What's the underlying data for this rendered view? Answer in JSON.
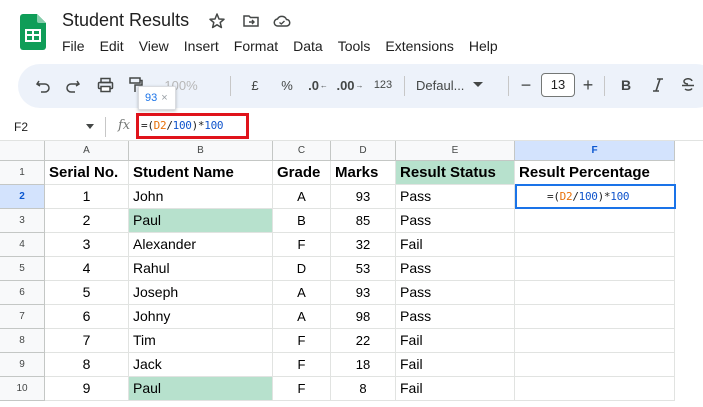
{
  "app": {
    "doc_title": "Student Results",
    "menu": [
      "File",
      "Edit",
      "View",
      "Insert",
      "Format",
      "Data",
      "Tools",
      "Extensions",
      "Help"
    ]
  },
  "toolbar": {
    "zoom": "100%",
    "currency": "£",
    "percent": "%",
    "dec_decrease": ".0",
    "dec_increase": ".00",
    "number_format": "123",
    "font": "Defaul...",
    "font_size": "13",
    "bold": "B",
    "minus": "−",
    "plus": "+"
  },
  "tooltip": {
    "value": "93",
    "close": "×"
  },
  "formula_bar": {
    "name_box": "F2",
    "fx": "fx",
    "tokens": [
      {
        "t": "=(",
        "k": "eq"
      },
      {
        "t": "D2",
        "k": "ref"
      },
      {
        "t": "/",
        "k": "op"
      },
      {
        "t": "100",
        "k": "num"
      },
      {
        "t": ")*",
        "k": "op"
      },
      {
        "t": "100",
        "k": "num"
      }
    ]
  },
  "sheet": {
    "columns": [
      "A",
      "B",
      "C",
      "D",
      "E",
      "F"
    ],
    "row_numbers": [
      "1",
      "2",
      "3",
      "4",
      "5",
      "6",
      "7",
      "8",
      "9",
      "10"
    ],
    "headers": [
      "Serial No.",
      "Student  Name",
      "Grade",
      "Marks",
      "Result Status",
      "Result Percentage"
    ],
    "rows": [
      [
        "1",
        "John",
        "A",
        "93",
        "Pass",
        ""
      ],
      [
        "2",
        "Paul",
        "B",
        "85",
        "Pass",
        ""
      ],
      [
        "3",
        "Alexander",
        "F",
        "32",
        "Fail",
        ""
      ],
      [
        "4",
        "Rahul",
        "D",
        "53",
        "Pass",
        ""
      ],
      [
        "5",
        "Joseph",
        "A",
        "93",
        "Pass",
        ""
      ],
      [
        "6",
        "Johny",
        "A",
        "98",
        "Pass",
        ""
      ],
      [
        "7",
        "Tim",
        "F",
        "22",
        "Fail",
        ""
      ],
      [
        "8",
        "Jack",
        "F",
        "18",
        "Fail",
        ""
      ],
      [
        "9",
        "Paul",
        "F",
        "8",
        "Fail",
        ""
      ]
    ],
    "active_cell": "F2",
    "highlight_color": "#b7e1cd",
    "selection_color": "#1a73e8"
  }
}
